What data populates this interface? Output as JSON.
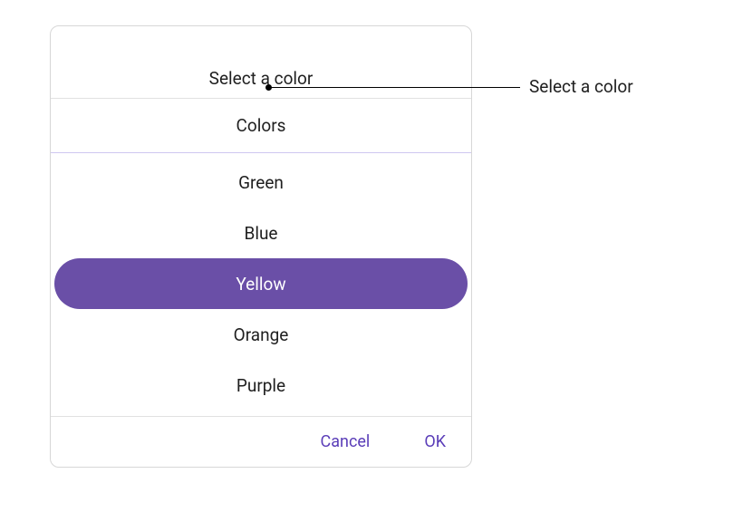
{
  "dialog": {
    "title": "Select a color",
    "category_label": "Colors",
    "selected_index": 2,
    "options": [
      {
        "label": "Green"
      },
      {
        "label": "Blue"
      },
      {
        "label": "Yellow"
      },
      {
        "label": "Orange"
      },
      {
        "label": "Purple"
      }
    ],
    "actions": {
      "cancel_label": "Cancel",
      "ok_label": "OK"
    }
  },
  "callout": {
    "label": "Select a color"
  },
  "colors": {
    "accent": "#6a4fa7",
    "button_text": "#5a3db8"
  }
}
